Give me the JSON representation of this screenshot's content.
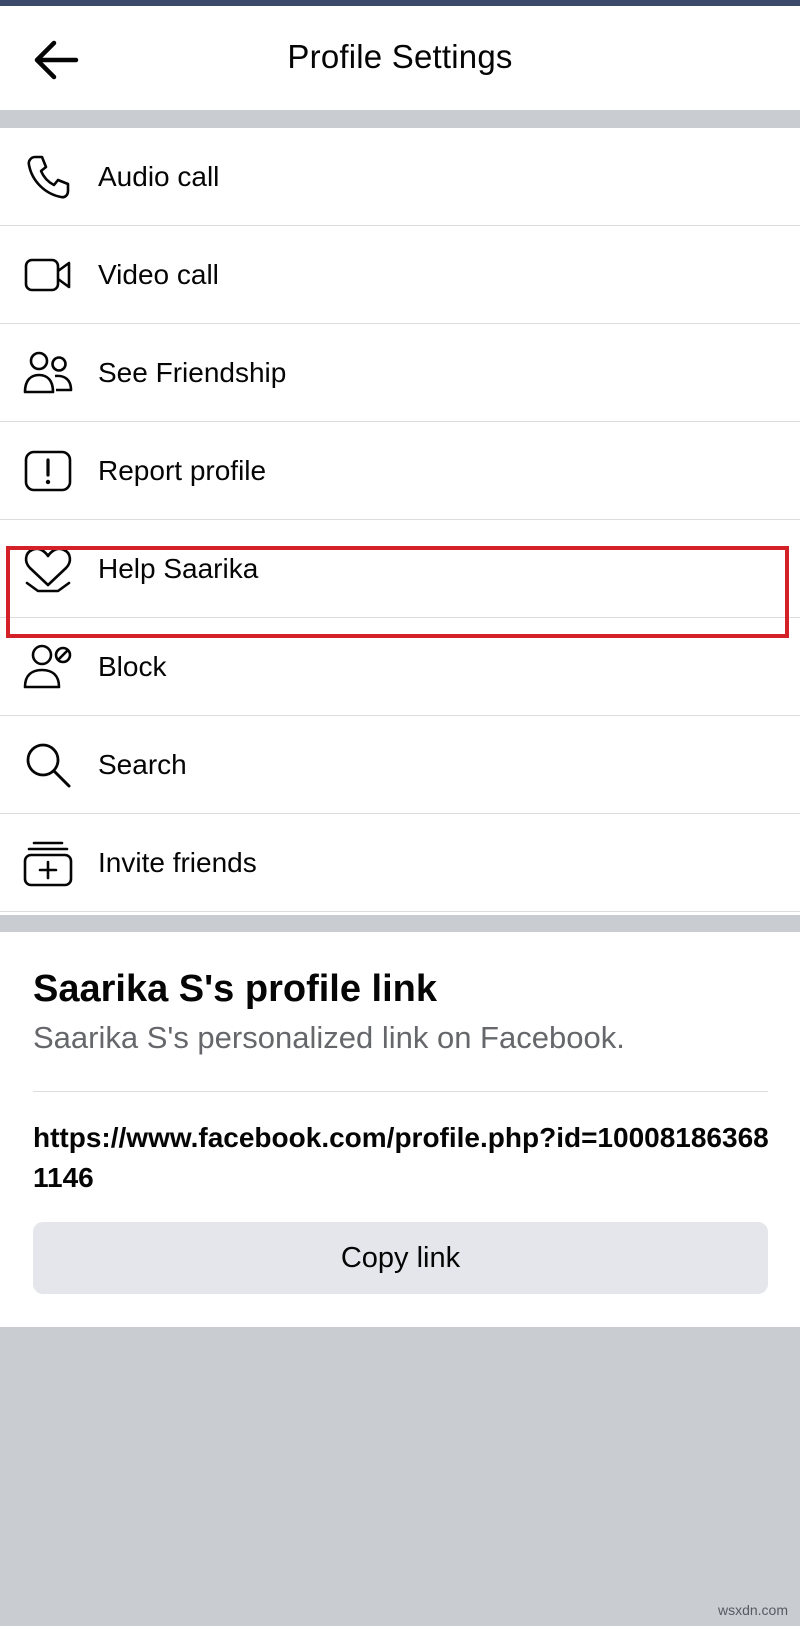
{
  "header": {
    "title": "Profile Settings"
  },
  "menu": {
    "items": [
      {
        "label": "Audio call",
        "icon": "phone-icon"
      },
      {
        "label": "Video call",
        "icon": "video-camera-icon"
      },
      {
        "label": "See Friendship",
        "icon": "friends-icon"
      },
      {
        "label": "Report profile",
        "icon": "report-icon"
      },
      {
        "label": "Help Saarika",
        "icon": "heart-icon"
      },
      {
        "label": "Block",
        "icon": "block-user-icon"
      },
      {
        "label": "Search",
        "icon": "search-icon"
      },
      {
        "label": "Invite friends",
        "icon": "invite-icon"
      }
    ]
  },
  "profile_link": {
    "title": "Saarika S's profile link",
    "subtitle": "Saarika S's personalized link on Facebook.",
    "url": "https://www.facebook.com/profile.php?id=100081863681146",
    "copy_label": "Copy link"
  },
  "watermark": "wsxdn.com",
  "colors": {
    "highlight": "#d42127",
    "page_background": "#c9ccd1",
    "button_background": "#e4e6eb",
    "secondary_text": "#65676b"
  }
}
